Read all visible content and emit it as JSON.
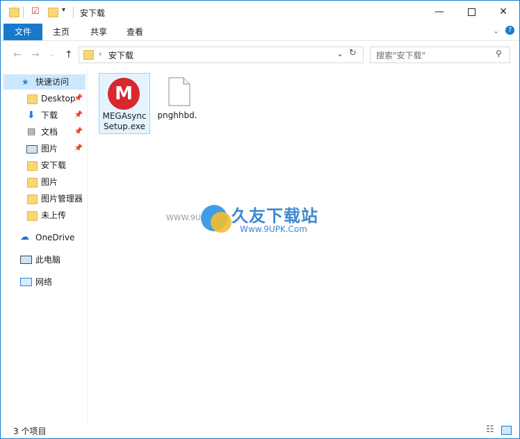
{
  "window": {
    "title": "安下载"
  },
  "ribbon": {
    "tabs": [
      "文件",
      "主页",
      "共享",
      "查看"
    ]
  },
  "address": {
    "path": "安下载",
    "search_placeholder": "搜索\"安下载\""
  },
  "nav": {
    "quick_access": "快速访问",
    "items": [
      {
        "label": "Desktop",
        "pinned": true
      },
      {
        "label": "下载",
        "pinned": true
      },
      {
        "label": "文档",
        "pinned": true
      },
      {
        "label": "图片",
        "pinned": true
      },
      {
        "label": "安下载",
        "pinned": false
      },
      {
        "label": "图片",
        "pinned": false
      },
      {
        "label": "图片管理器",
        "pinned": false
      },
      {
        "label": "未上传",
        "pinned": false
      }
    ],
    "onedrive": "OneDrive",
    "this_pc": "此电脑",
    "network": "网络"
  },
  "files": [
    {
      "name_line1": "MEGAsync",
      "name_line2": "Setup.exe",
      "icon": "mega-app-icon"
    },
    {
      "name_line1": "pnghhbd.",
      "name_line2": "",
      "icon": "blank-file-icon"
    }
  ],
  "watermark": {
    "cn": "久友下载站",
    "url": "Www.9UPK.Com",
    "left": "WWW.9U"
  },
  "status": {
    "count": "3 个项目"
  }
}
